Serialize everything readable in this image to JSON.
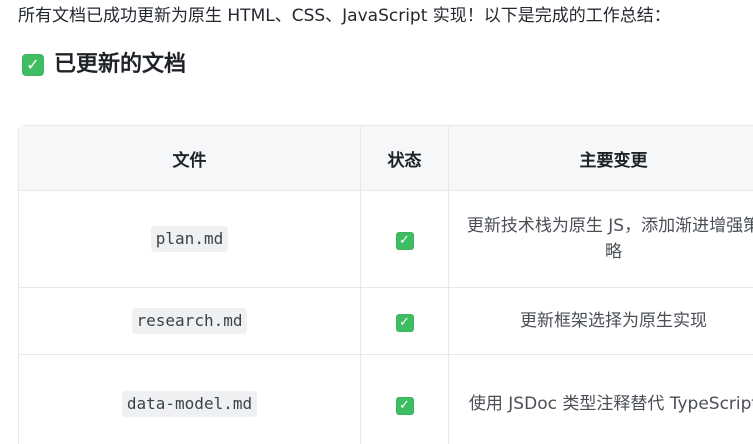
{
  "intro": {
    "text": "所有文档已成功更新为原生 HTML、CSS、JavaScript 实现！以下是完成的工作总结："
  },
  "section": {
    "title": "已更新的文档",
    "icon": "check-mark-button-icon"
  },
  "table": {
    "headers": [
      "文件",
      "状态",
      "主要变更"
    ],
    "rows": [
      {
        "file": "plan.md",
        "status_icon": "check-mark-button-icon",
        "change": "更新技术栈为原生 JS，添加渐进增强策略"
      },
      {
        "file": "research.md",
        "status_icon": "check-mark-button-icon",
        "change": "更新框架选择为原生实现"
      },
      {
        "file": "data-model.md",
        "status_icon": "check-mark-button-icon",
        "change": "使用 JSDoc 类型注释替代 TypeScript"
      }
    ]
  },
  "colors": {
    "check_green": "#3fbd62",
    "header_bg": "#f6f7f9",
    "border": "#e6e8eb",
    "code_bg": "#eef0f2"
  }
}
